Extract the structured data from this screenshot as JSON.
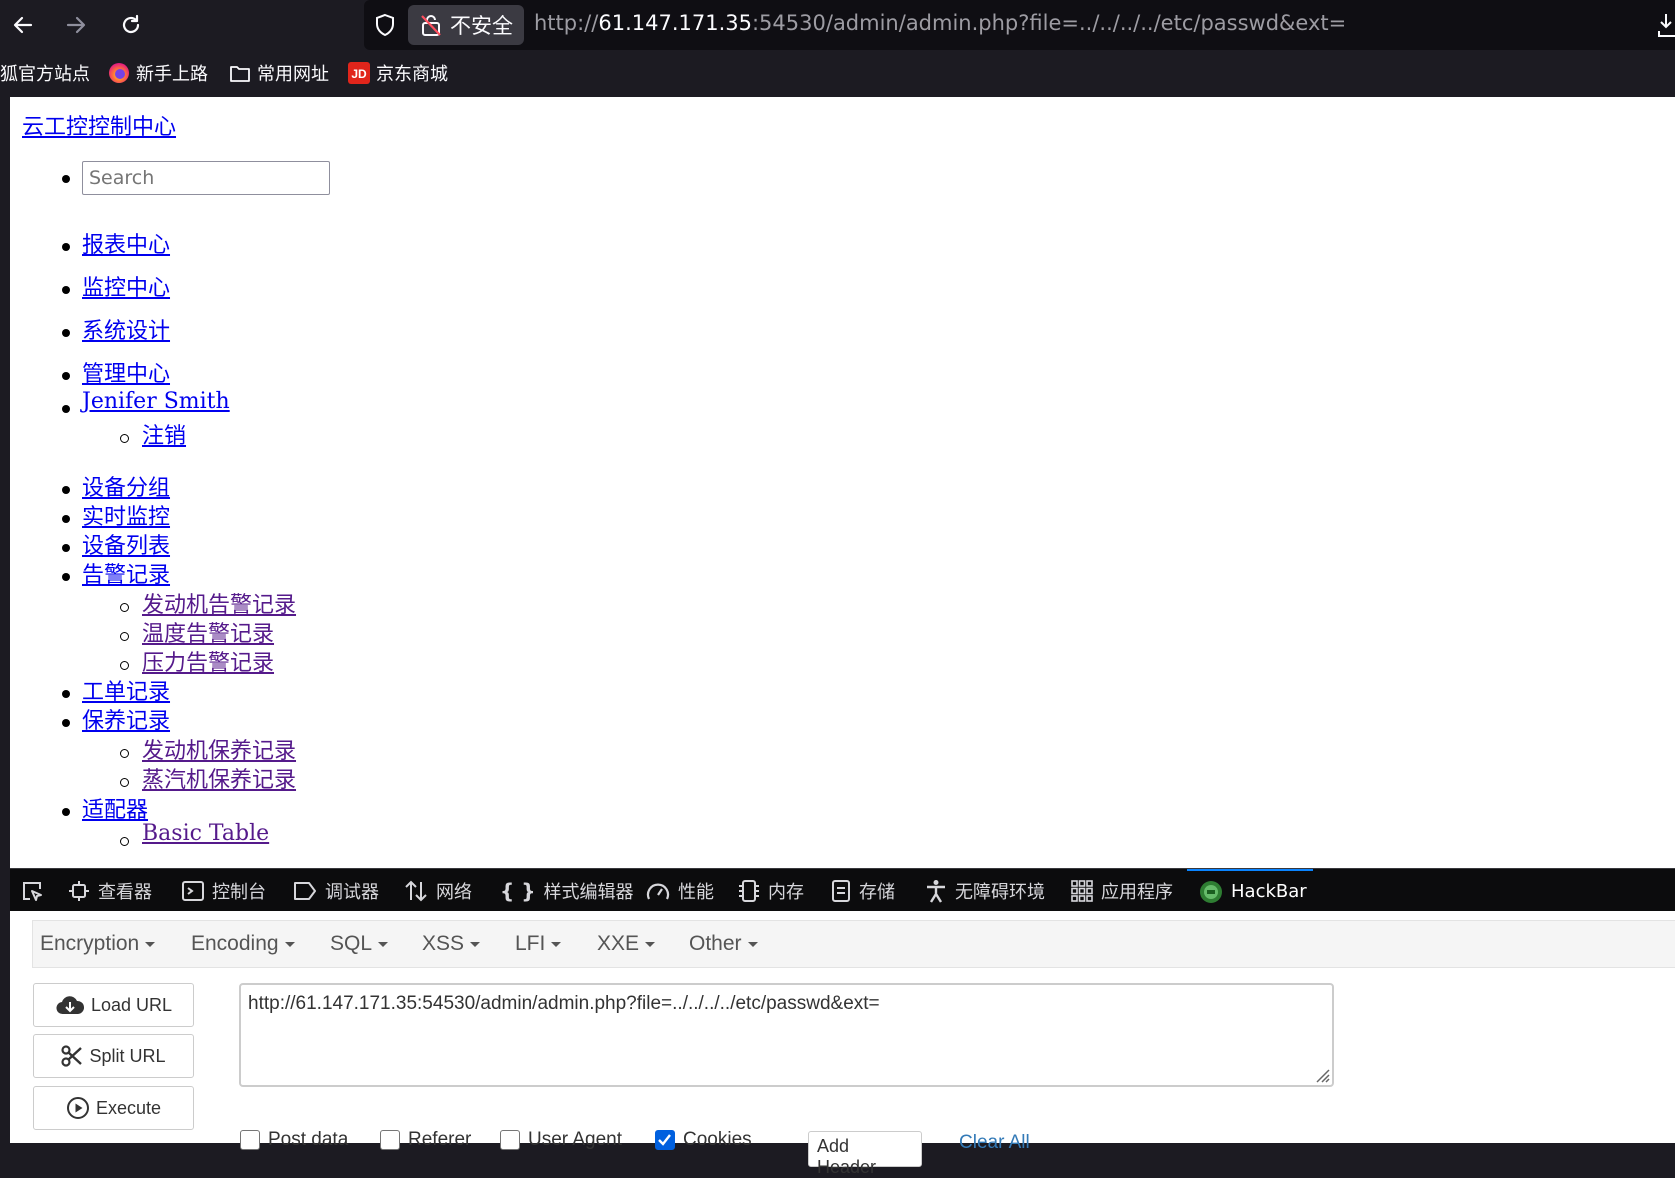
{
  "browser": {
    "insecure_label": "不安全",
    "url_scheme": "http://",
    "url_host": "61.147.171.35",
    "url_rest": ":54530/admin/admin.php?file=../../../../etc/passwd&ext=",
    "bookmarks": [
      {
        "label": "狐官方站点",
        "icon": "firefox-folder-icon"
      },
      {
        "label": "新手上路",
        "icon": "firefox-icon"
      },
      {
        "label": "常用网址",
        "icon": "folder-icon"
      },
      {
        "label": "京东商城",
        "icon": "jd-icon"
      }
    ]
  },
  "page": {
    "brand": "云工控控制中心",
    "search_placeholder": "Search",
    "top_nav": [
      "报表中心",
      "监控中心",
      "系统设计",
      "管理中心"
    ],
    "user": {
      "name": " Jenifer Smith",
      "logout": "注销"
    },
    "side_nav": {
      "group": "设备分组",
      "realtime": "实时监控",
      "list": "设备列表",
      "alarms": "告警记录",
      "alarm_items": [
        "发动机告警记录",
        "温度告警记录",
        "压力告警记录"
      ],
      "orders": "工单记录",
      "maint": "保养记录",
      "maint_items": [
        "发动机保养记录",
        "蒸汽机保养记录"
      ],
      "adapter": "适配器",
      "adapter_items": [
        "Basic Table"
      ]
    }
  },
  "devtools": {
    "tabs": [
      "查看器",
      "控制台",
      "调试器",
      "网络",
      "样式编辑器",
      "性能",
      "内存",
      "存储",
      "无障碍环境",
      "应用程序",
      "HackBar"
    ],
    "active_tab": "HackBar",
    "accent": "#0a84ff"
  },
  "hackbar": {
    "menu": [
      "Encryption",
      "Encoding",
      "SQL",
      "XSS",
      "LFI",
      "XXE",
      "Other"
    ],
    "buttons": {
      "load": "Load URL",
      "split": "Split URL",
      "execute": "Execute"
    },
    "url": "http://61.147.171.35:54530/admin/admin.php?file=../../../../etc/passwd&ext=",
    "checks": [
      {
        "label": "Post data",
        "checked": false
      },
      {
        "label": "Referer",
        "checked": false
      },
      {
        "label": "User Agent",
        "checked": false
      },
      {
        "label": "Cookies",
        "checked": true
      }
    ],
    "add_header": "Add Header",
    "clear_all": "Clear All"
  }
}
